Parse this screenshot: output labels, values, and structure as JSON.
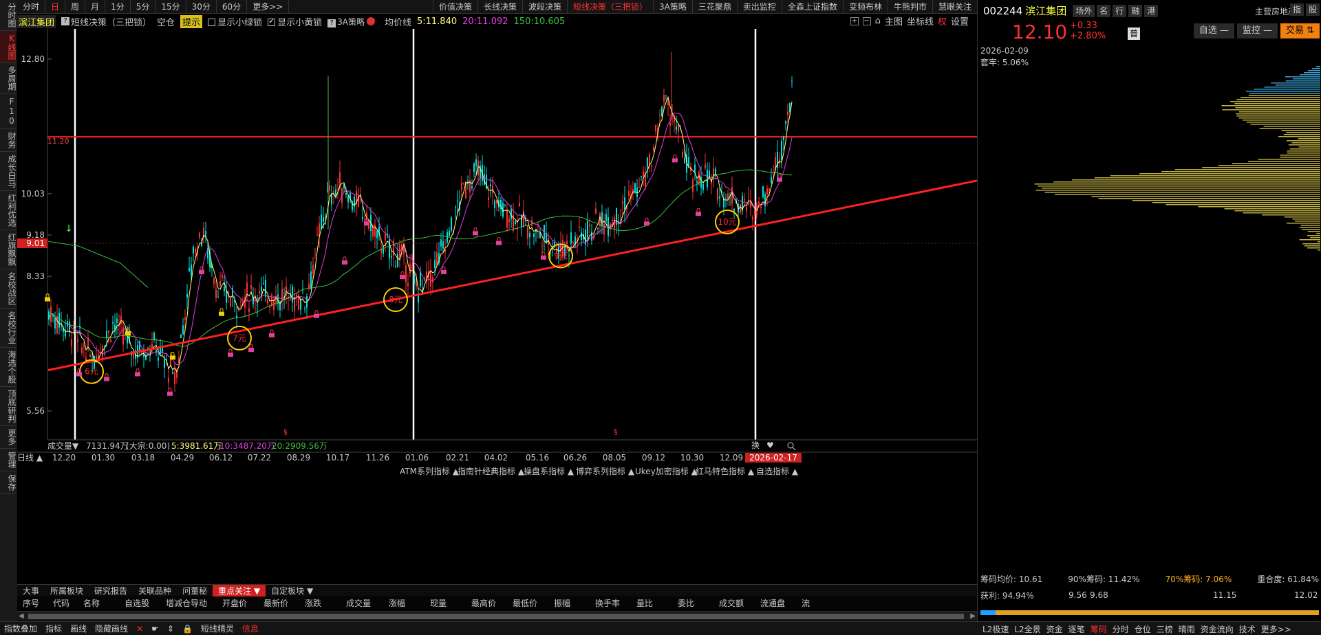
{
  "leftnav": [
    "分时图",
    "K线图",
    "多周期",
    "F10",
    "财务",
    "成长白马",
    "红利优选",
    "红旗飘飘",
    "名校战区",
    "名校行业",
    "海选个股",
    "顶底研判",
    "更多",
    "管理",
    "保存"
  ],
  "toolbar": {
    "periods": [
      "分时",
      "日",
      "周",
      "月",
      "1分",
      "5分",
      "15分",
      "30分",
      "60分",
      "更多>>"
    ],
    "active_period": "日",
    "strategy_tabs": [
      "价值决策",
      "长线决策",
      "波段决策",
      "短线决策（三把锁）",
      "3A策略",
      "三花聚鼎",
      "卖出监控",
      "全森上证指数",
      "变频布林",
      "牛熊判市",
      "慧眼关注"
    ],
    "active_strategy": "短线决策（三把锁）"
  },
  "inforow": {
    "stock_name": "滨江集团",
    "indicator": "短线决策（三把锁）",
    "position": "空仓",
    "tip": "提示",
    "show_green": "显示小绿锁",
    "show_yellow": "显示小黄锁",
    "strategy_3a": "3A策略",
    "ma_label": "均价线",
    "ma5": "5:11.840",
    "ma20": "20:11.092",
    "ma150": "150:10.605",
    "right_tools": [
      "主图",
      "坐标线",
      "权",
      "设置"
    ]
  },
  "chart": {
    "y_labels": [
      "12.80",
      "10.03",
      "9.18",
      "8.33",
      "5.56"
    ],
    "current_price_tag": "9.01",
    "resistance_label": "11.20",
    "annotations": [
      "6元",
      "7元",
      "8元",
      "9元",
      "10元"
    ],
    "volume_line": {
      "label": "成交量▼",
      "value": "7131.94万",
      "big": "(大宗:0.00)",
      "v5": "5:3981.61万",
      "v10": "10:3487.20万",
      "v20": "20:2909.56万"
    },
    "x_labels": [
      "12.20",
      "01.30",
      "03.18",
      "04.29",
      "06.12",
      "07.22",
      "08.29",
      "10.17",
      "11.26",
      "01.06",
      "02.21",
      "04.02",
      "05.16",
      "06.26",
      "08.05",
      "09.12",
      "10.30",
      "12.09"
    ],
    "date_badge": "2026-02-17",
    "period_label": "日线",
    "indicator_tabs": [
      "ATM系列指标 ▲",
      "指南针经典指标 ▲",
      "操盘系指标 ▲",
      "博弈系列指标 ▲",
      "Ukey加密指标 ▲",
      "红马特色指标 ▲",
      "自选指标 ▲"
    ],
    "vol_tools": [
      "换",
      "♥"
    ]
  },
  "bottom_tabs": [
    "大事",
    "所属板块",
    "研究报告",
    "关联品种",
    "问董秘",
    "重点关注 ▼",
    "自定板块 ▼"
  ],
  "active_bottom_tab": "重点关注 ▼",
  "table_headers": [
    "序号",
    "代码",
    "名称",
    "自选股",
    "增减仓导动",
    "开盘价",
    "最新价",
    "涨跌",
    "成交量",
    "涨幅",
    "现量",
    "最高价",
    "最低价",
    "振幅",
    "换手率",
    "量比",
    "委比",
    "成交额",
    "流通盘",
    "流"
  ],
  "statusbar": [
    "指数叠加",
    "指标",
    "画线",
    "隐藏画线",
    "✕",
    "☛",
    "⇕",
    "🔒",
    "短线精灵",
    "信息"
  ],
  "right": {
    "code": "002244",
    "name": "滨江集团",
    "tags": [
      "场外",
      "名",
      "行",
      "融",
      "港"
    ],
    "sector": "主营房地产",
    "sector_tags": [
      "指",
      "股"
    ],
    "price": "12.10",
    "change": "+0.33",
    "change_pct": "+2.80%",
    "badge": "普",
    "buttons": [
      "自选 —",
      "监控 —",
      "交易 ⇅"
    ],
    "date": "2026-02-09",
    "trapped": "套牢: 5.06%",
    "chips_avg": "筹码均价: 10.61",
    "chips_90": "90%筹码: 11.42%",
    "chips_70": "70%筹码: 7.06%",
    "overlap": "重合度: 61.84%",
    "profit": "获利: 94.94%",
    "range_labels": [
      "9.56",
      "9.68",
      "11.15",
      "12.02"
    ],
    "bottom_tabs": [
      "L2极速",
      "L2全景",
      "资金",
      "逐笔",
      "筹码",
      "分时",
      "仓位",
      "三榜",
      "晴雨",
      "资金流向",
      "技术",
      "更多>>"
    ],
    "active_bottom_tab": "筹码"
  },
  "colors": {
    "up": "#ff3030",
    "down": "#00e0e0",
    "ma5": "#ffff80",
    "ma20": "#e040e0",
    "ma150": "#40c040",
    "trend_line": "#ff2020",
    "circle": "#ffd000"
  }
}
